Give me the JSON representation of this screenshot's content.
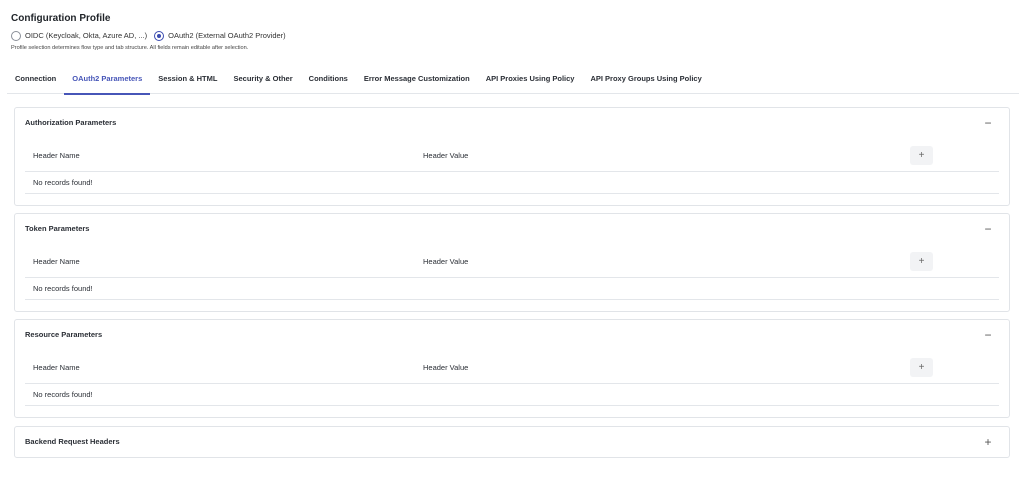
{
  "profile": {
    "title": "Configuration Profile",
    "options": [
      {
        "label": "OIDC (Keycloak, Okta, Azure AD, ...)",
        "checked": false
      },
      {
        "label": "OAuth2 (External OAuth2 Provider)",
        "checked": true
      }
    ],
    "hint": "Profile selection determines flow type and tab structure. All fields remain editable after selection."
  },
  "tabs": [
    {
      "label": "Connection"
    },
    {
      "label": "OAuth2 Parameters",
      "active": true
    },
    {
      "label": "Session & HTML"
    },
    {
      "label": "Security & Other"
    },
    {
      "label": "Conditions"
    },
    {
      "label": "Error Message Customization"
    },
    {
      "label": "API Proxies Using Policy"
    },
    {
      "label": "API Proxy Groups Using Policy"
    }
  ],
  "panels": {
    "authorization": {
      "title": "Authorization Parameters",
      "toggle": "−",
      "col_name": "Header Name",
      "col_value": "Header Value",
      "add": "+",
      "empty": "No records found!"
    },
    "token": {
      "title": "Token Parameters",
      "toggle": "−",
      "col_name": "Header Name",
      "col_value": "Header Value",
      "add": "+",
      "empty": "No records found!"
    },
    "resource": {
      "title": "Resource Parameters",
      "toggle": "−",
      "col_name": "Header Name",
      "col_value": "Header Value",
      "add": "+",
      "empty": "No records found!"
    },
    "backend": {
      "title": "Backend Request Headers",
      "toggle": "+"
    }
  }
}
